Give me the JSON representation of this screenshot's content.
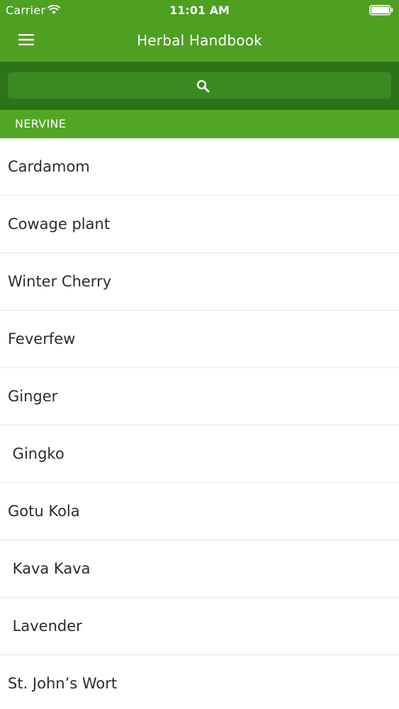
{
  "status_bar": {
    "carrier": "Carrier",
    "time": "11:01 AM",
    "icons": [
      "wifi-icon",
      "battery-icon"
    ]
  },
  "nav": {
    "title": "Herbal Handbook",
    "menu_icon": "hamburger-menu-icon"
  },
  "search": {
    "icon": "search-icon",
    "placeholder": ""
  },
  "section": {
    "title": "NERVINE"
  },
  "herbs": [
    "Cardamom",
    "Cowage plant",
    "Winter Cherry",
    "Feverfew",
    "Ginger",
    " Gingko",
    "Gotu Kola",
    " Kava Kava",
    " Lavender",
    "St. John’s Wort"
  ],
  "colors": {
    "nav_green": "#4e9f22",
    "search_bg": "#2f7318",
    "search_field": "#3a8a21",
    "section_green": "#53a526",
    "text": "#2b2b2b",
    "divider": "#e6e6e6"
  }
}
